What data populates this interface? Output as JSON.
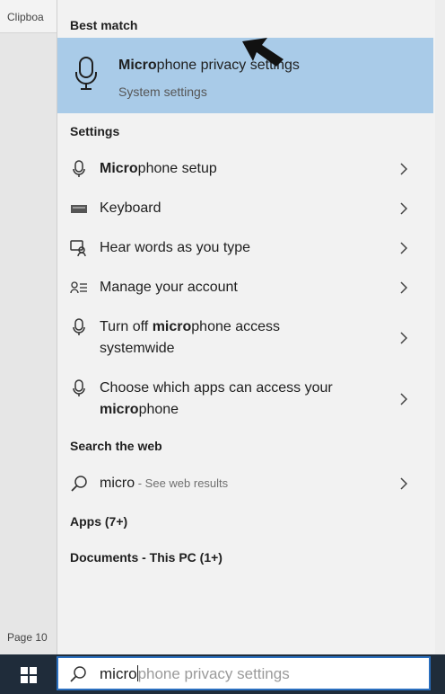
{
  "background": {
    "ribbon_label": "Clipboa",
    "status_label": "Page 10"
  },
  "sections": {
    "best_match": "Best match",
    "settings": "Settings",
    "search_web": "Search the web",
    "apps": "Apps (7+)",
    "documents": "Documents - This PC (1+)"
  },
  "best_match": {
    "title_bold": "Micro",
    "title_rest": "phone privacy settings",
    "subtitle": "System settings",
    "icon": "microphone-icon"
  },
  "settings_items": [
    {
      "icon": "microphone-icon",
      "bold_prefix": "Micro",
      "text": "phone setup"
    },
    {
      "icon": "keyboard-icon",
      "bold_prefix": "",
      "text": "Keyboard"
    },
    {
      "icon": "speech-icon",
      "bold_prefix": "",
      "text": "Hear words as you type"
    },
    {
      "icon": "account-icon",
      "bold_prefix": "",
      "text": "Manage your account"
    },
    {
      "icon": "microphone-icon",
      "line1_pre": "Turn off ",
      "line1_bold": "micro",
      "line1_post": "phone access",
      "line2": "systemwide"
    },
    {
      "icon": "microphone-icon",
      "line1": "Choose which apps can access your",
      "line2_bold": "micro",
      "line2_post": "phone"
    }
  ],
  "web": {
    "query": "micro",
    "suffix": " - See web results",
    "icon": "search-icon"
  },
  "search_box": {
    "typed": "micro",
    "completion": "phone privacy settings",
    "icon": "search-icon"
  },
  "colors": {
    "highlight": "#a9cbe8",
    "panel": "#f2f2f2",
    "taskbar": "#1f2c3a",
    "search_border": "#2a6fbf"
  }
}
